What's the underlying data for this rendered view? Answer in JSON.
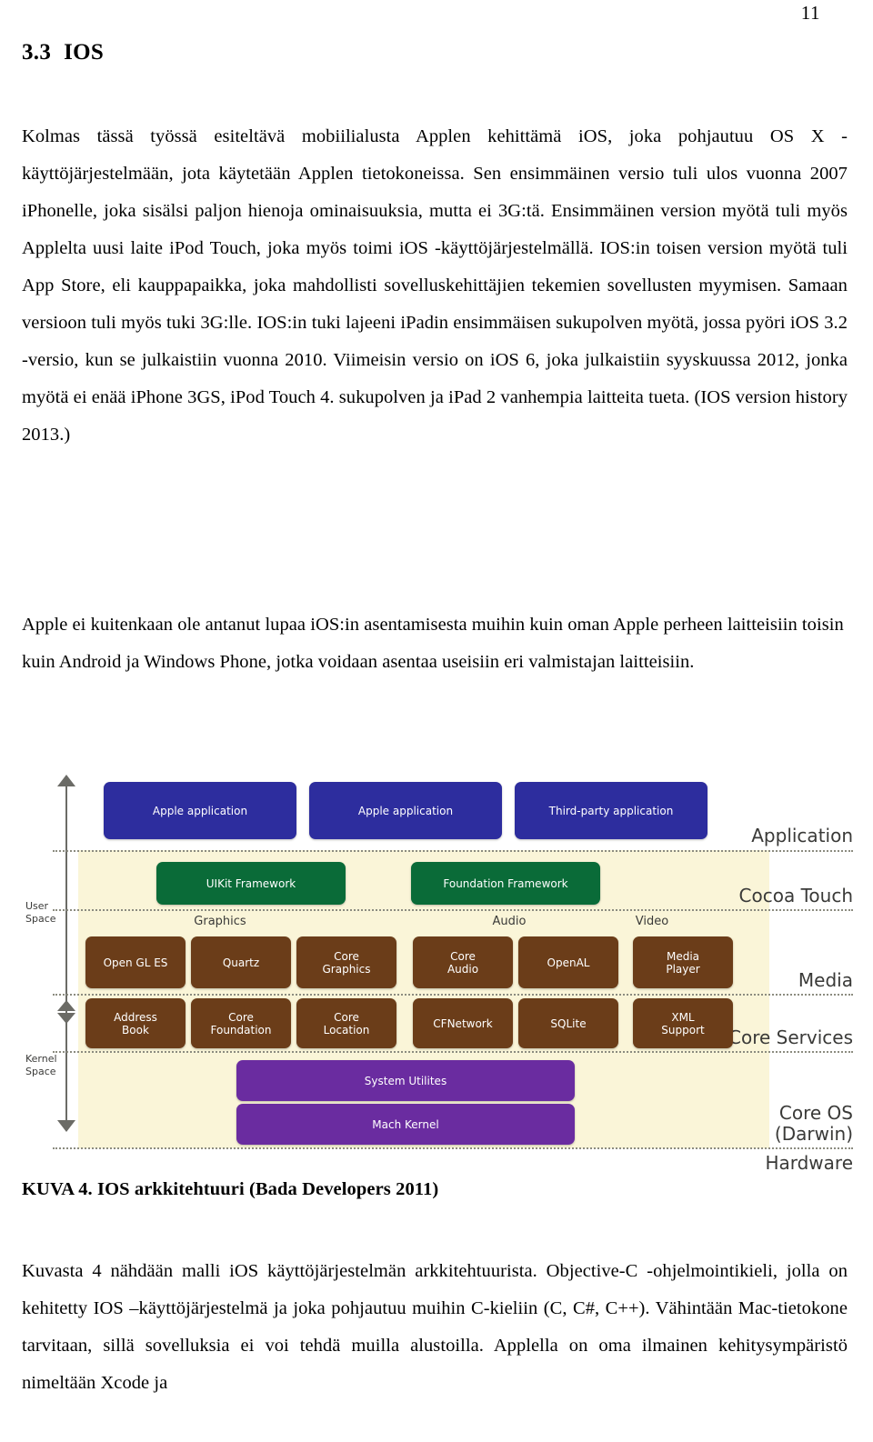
{
  "page": {
    "number": "11"
  },
  "heading": {
    "number": "3.3",
    "title": "IOS"
  },
  "paragraphs": {
    "p1": "Kolmas tässä työssä esiteltävä mobiilialusta Applen kehittämä iOS, joka pohjautuu OS X -käyttöjärjestelmään, jota käytetään Applen tietokoneissa. Sen ensimmäinen versio tuli ulos vuonna 2007 iPhonelle, joka sisälsi paljon hienoja ominaisuuksia, mutta ei 3G:tä. Ensimmäinen version myötä tuli myös Applelta uusi laite iPod Touch, joka myös toimi iOS -käyttöjärjestelmällä. IOS:in toisen version myötä tuli App Store, eli kauppapaikka, joka mahdollisti sovelluskehittäjien tekemien sovellusten myymisen. Samaan versioon tuli myös tuki 3G:lle. IOS:in tuki lajeeni iPadin ensimmäisen sukupolven myötä, jossa pyöri iOS 3.2 -versio, kun se julkaistiin vuonna 2010. Viimeisin versio on iOS 6, joka julkaistiin syyskuussa 2012, jonka myötä ei enää iPhone 3GS, iPod Touch 4. sukupolven ja iPad 2 vanhempia laitteita tueta. (IOS version history 2013.)",
    "p2": "Apple ei kuitenkaan ole antanut lupaa iOS:in asentamisesta muihin kuin oman Apple perheen laitteisiin toisin kuin Android ja Windows Phone, jotka voidaan asentaa useisiin eri valmistajan laitteisiin.",
    "p3": "Kuvasta 4 nähdään malli iOS käyttöjärjestelmän arkkitehtuurista. Objective-C -ohjelmointikieli, jolla on kehitetty IOS –käyttöjärjestelmä ja joka pohjautuu muihin C-kieliin (C, C#, C++). Vähintään Mac-tietokone tarvitaan, sillä sovelluksia ei voi tehdä muilla alustoilla. Applella on oma ilmainen kehitysympäristö nimeltään Xcode ja"
  },
  "figure": {
    "caption": "KUVA 4. IOS arkkitehtuuri (Bada Developers 2011)",
    "space_labels": {
      "user": "User\nSpace",
      "user_line1": "User",
      "user_line2": "Space",
      "kernel_line1": "Kernel",
      "kernel_line2": "Space"
    },
    "layer_labels": [
      "Application",
      "Cocoa Touch",
      "Media",
      "Core Services",
      "Core OS",
      "(Darwin)",
      "Hardware"
    ],
    "group_labels": [
      "Graphics",
      "Audio",
      "Video"
    ],
    "boxes": {
      "application": [
        "Apple application",
        "Apple application",
        "Third-party application"
      ],
      "cocoa_touch": [
        "UIKit Framework",
        "Foundation Framework"
      ],
      "media": [
        "Open GL ES",
        "Quartz",
        "Core\nGraphics",
        "Core\nAudio",
        "OpenAL",
        "Media\nPlayer"
      ],
      "media_lines": [
        [
          "Open GL ES"
        ],
        [
          "Quartz"
        ],
        [
          "Core",
          "Graphics"
        ],
        [
          "Core",
          "Audio"
        ],
        [
          "OpenAL"
        ],
        [
          "Media",
          "Player"
        ]
      ],
      "core_services_lines": [
        [
          "Address",
          "Book"
        ],
        [
          "Core",
          "Foundation"
        ],
        [
          "Core",
          "Location"
        ],
        [
          "CFNetwork"
        ],
        [
          "SQLite"
        ],
        [
          "XML",
          "Support"
        ]
      ],
      "core_os": [
        "System Utilites",
        "Mach Kernel"
      ]
    },
    "colors": {
      "application_box": "#2d2d9e",
      "cocoa_box": "#0a6b38",
      "media_box": "#6b3d19",
      "kernel_box": "#6a2ca0",
      "band_background": "#faf5d8"
    }
  }
}
